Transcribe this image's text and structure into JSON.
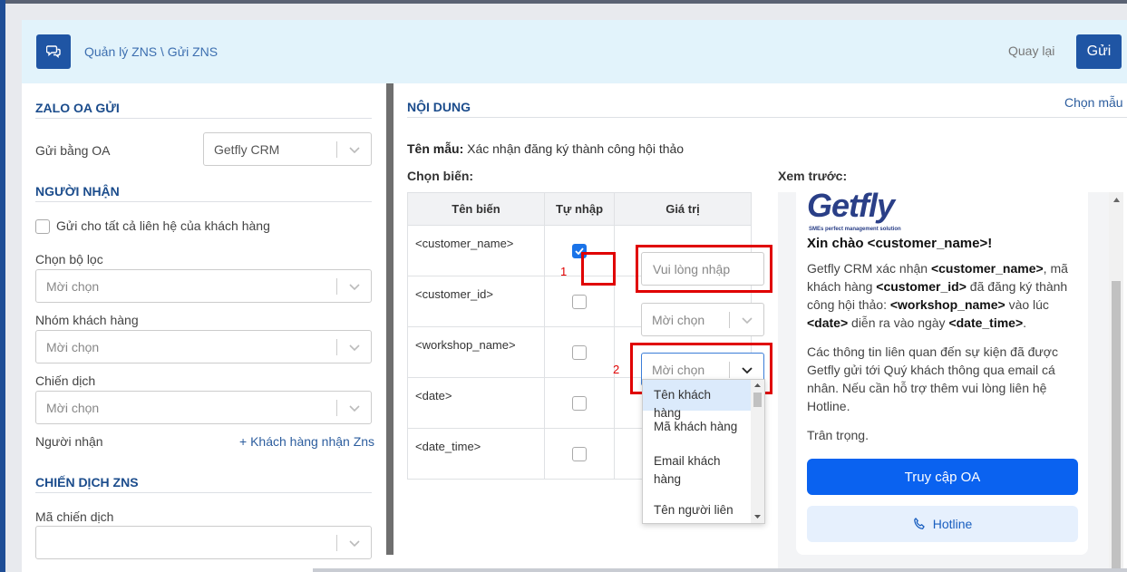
{
  "header": {
    "breadcrumb": "Quản lý ZNS \\ Gửi ZNS",
    "back_label": "Quay lại",
    "send_label": "Gửi"
  },
  "left": {
    "section_oa": "ZALO OA GỬI",
    "send_by_oa_label": "Gửi bằng OA",
    "send_by_oa_value": "Getfly CRM",
    "section_recipient": "NGƯỜI NHẬN",
    "send_all_label": "Gửi cho tất cả liên hệ của khách hàng",
    "filter_label": "Chọn bộ lọc",
    "filter_placeholder": "Mời chọn",
    "group_label": "Nhóm khách hàng",
    "group_placeholder": "Mời chọn",
    "campaign_label": "Chiến dịch",
    "campaign_placeholder": "Mời chọn",
    "recipient_label": "Người nhận",
    "recipient_link": "+ Khách hàng nhận Zns",
    "section_zns": "CHIẾN DỊCH ZNS",
    "campaign_code_label": "Mã chiến dịch"
  },
  "content": {
    "title": "NỘI DUNG",
    "choose_template": "Chọn mẫu",
    "template_label": "Tên mẫu:",
    "template_value": "Xác nhận đăng ký thành công hội thảo",
    "choose_vars": "Chọn biến:",
    "preview_label": "Xem trước:",
    "table": {
      "headers": [
        "Tên biến",
        "Tự nhập",
        "Giá trị"
      ],
      "rows": [
        {
          "name": "<customer_name>",
          "checked": true
        },
        {
          "name": "<customer_id>",
          "checked": false
        },
        {
          "name": "<workshop_name>",
          "checked": false
        },
        {
          "name": "<date>",
          "checked": false
        },
        {
          "name": "<date_time>",
          "checked": false
        }
      ],
      "input_placeholder": "Vui lòng nhập",
      "select_placeholder": "Mời chọn"
    },
    "annotations": [
      "1",
      "2"
    ],
    "dropdown_options": [
      "Tên khách hàng",
      "Mã khách hàng",
      "Email khách hàng",
      "Tên người liên hệ"
    ]
  },
  "preview": {
    "logo": "Getfly",
    "logo_tagline": "SMEs perfect management solution",
    "greeting": "Xin chào <customer_name>!",
    "p1_a": "Getfly CRM xác nhận ",
    "p1_b": "<customer_name>",
    "p1_c": ", mã khách hàng ",
    "p1_d": "<customer_id>",
    "p1_e": " đã đăng ký thành công hội thảo: ",
    "p1_f": "<workshop_name>",
    "p1_g": " vào lúc ",
    "p1_h": "<date>",
    "p1_i": " diễn ra vào ngày ",
    "p1_j": "<date_time>",
    "p1_k": ".",
    "p2": "Các thông tin liên quan đến sự kiện đã được Getfly gửi tới Quý khách thông qua email cá nhân. Nếu cần hỗ trợ thêm vui lòng liên hệ Hotline.",
    "p3": "Trân trọng.",
    "btn_oa": "Truy cập OA",
    "btn_hotline": "Hotline"
  },
  "colors": {
    "primary": "#1f55a4",
    "header_bg": "#e2f3fb",
    "annotation": "#e00000",
    "cta": "#0a62f0"
  }
}
